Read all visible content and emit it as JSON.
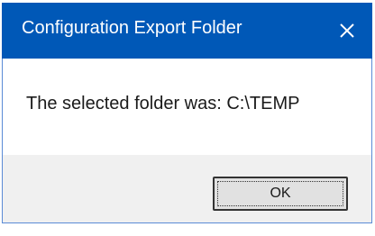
{
  "window": {
    "title": "Configuration Export Folder",
    "close_icon": "close-icon"
  },
  "message": {
    "text": "The selected folder was: C:\\TEMP"
  },
  "buttons": {
    "ok_label": "OK"
  },
  "colors": {
    "titlebar": "#0058b7",
    "title_text": "#ffffff",
    "footer_bg": "#f0f0f0",
    "button_bg": "#e1e1e1"
  }
}
